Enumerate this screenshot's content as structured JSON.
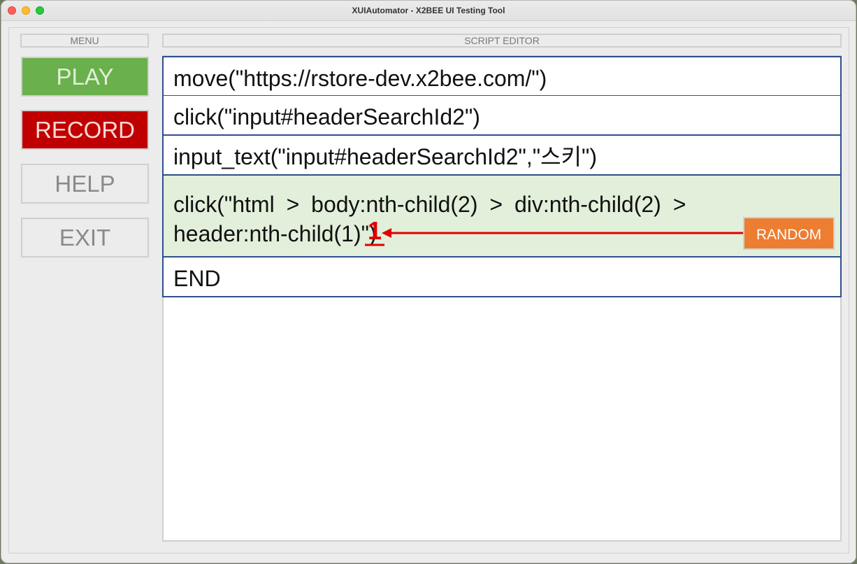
{
  "window": {
    "title": "XUIAutomator - X2BEE UI Testing Tool"
  },
  "menu": {
    "label": "MENU",
    "buttons": {
      "play": "PLAY",
      "record": "RECORD",
      "help": "HELP",
      "exit": "EXIT"
    },
    "colors": {
      "play": "#6ab04c",
      "record": "#c00000"
    }
  },
  "editor": {
    "label": "SCRIPT EDITOR",
    "lines": [
      "move(\"https://rstore-dev.x2bee.com/\")",
      "click(\"input#headerSearchId2\")",
      "input_text(\"input#headerSearchId2\",\"스키\")",
      "click(\"html > body:nth-child(2) > div:nth-child(2) >",
      "header:nth-child(1)\")",
      "END"
    ],
    "selected_line_color": "#e2efda",
    "random_button": "RANDOM",
    "random_button_color": "#ed7d31"
  },
  "annotation": {
    "number": "1",
    "color": "#e00000"
  }
}
